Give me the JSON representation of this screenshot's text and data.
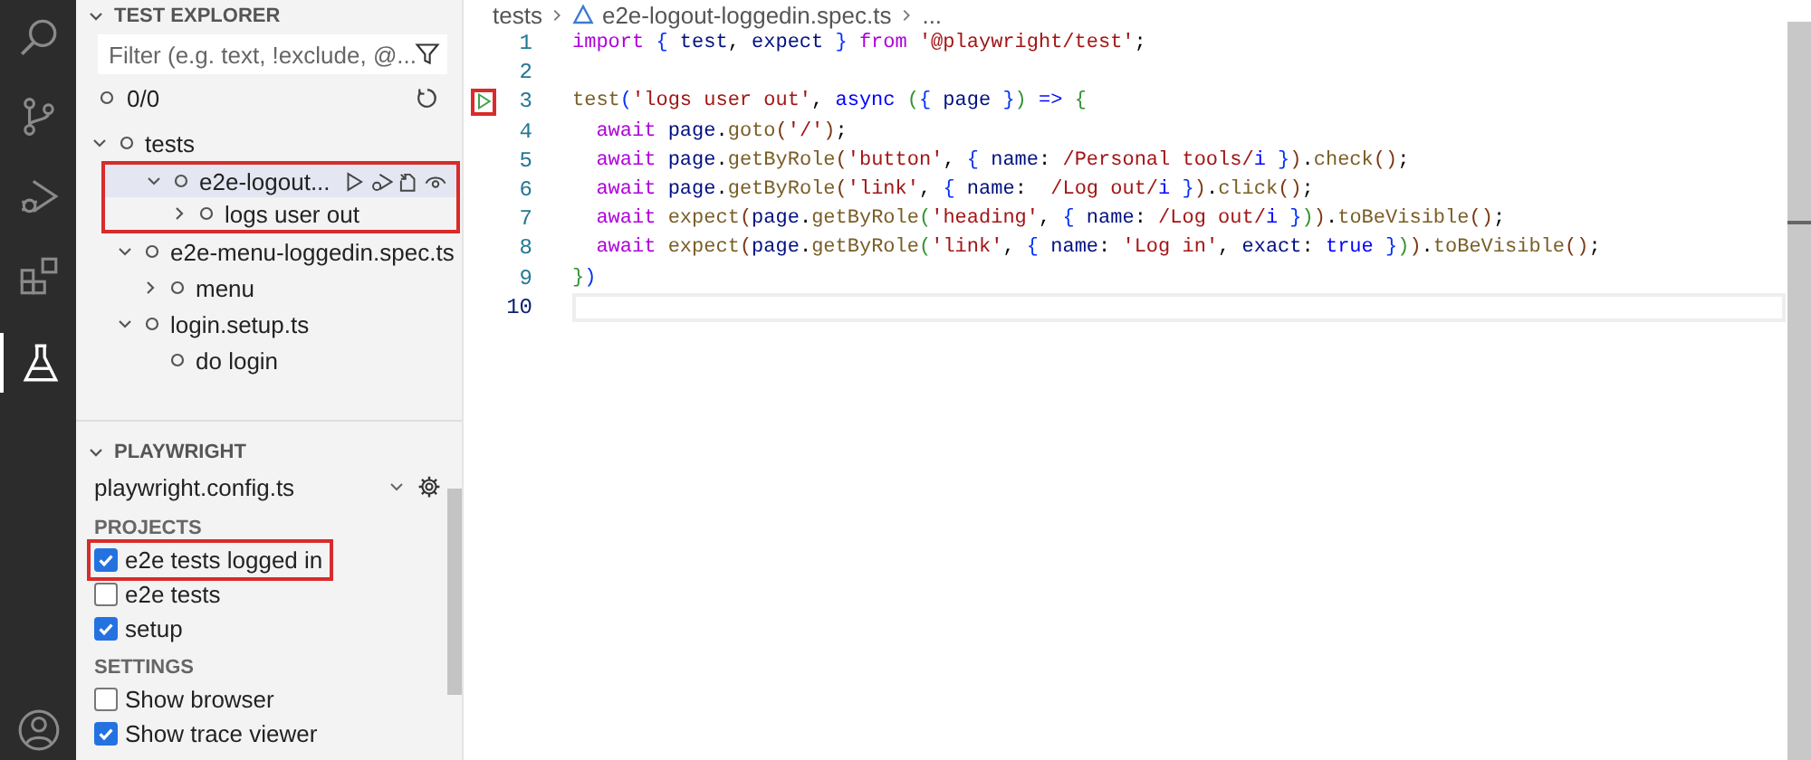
{
  "explorer": {
    "title": "TEST EXPLORER",
    "filter": {
      "placeholder": "Filter (e.g. text, !exclude, @..."
    },
    "summary": "0/0",
    "tree": [
      {
        "label": "tests",
        "expanded": true,
        "selected": false,
        "highlighted": false,
        "children": [
          {
            "label": "e2e-logout...",
            "expanded": true,
            "selected": true,
            "highlighted": true,
            "children": [
              {
                "label": "logs user out",
                "expanded": false,
                "selected": false,
                "highlighted": true
              }
            ]
          },
          {
            "label": "e2e-menu-loggedin.spec.ts",
            "expanded": true,
            "selected": false,
            "highlighted": false,
            "children": [
              {
                "label": "menu",
                "expanded": false,
                "selected": false,
                "highlighted": false
              }
            ]
          },
          {
            "label": "login.setup.ts",
            "expanded": true,
            "selected": false,
            "highlighted": false,
            "children": [
              {
                "label": "do login",
                "selected": false,
                "highlighted": false
              }
            ]
          }
        ]
      }
    ]
  },
  "playwright": {
    "title": "PLAYWRIGHT",
    "config": "playwright.config.ts",
    "sections": [
      {
        "title": "PROJECTS",
        "items": [
          {
            "label": "e2e tests logged in",
            "checked": true,
            "highlighted": true
          },
          {
            "label": "e2e tests",
            "checked": false,
            "highlighted": false
          },
          {
            "label": "setup",
            "checked": true,
            "highlighted": false
          }
        ]
      },
      {
        "title": "SETTINGS",
        "items": [
          {
            "label": "Show browser",
            "checked": false,
            "highlighted": false
          },
          {
            "label": "Show trace viewer",
            "checked": true,
            "highlighted": false
          }
        ]
      }
    ]
  },
  "breadcrumb": [
    "tests",
    "e2e-logout-loggedin.spec.ts",
    "..."
  ],
  "editor": {
    "lines": [
      {
        "number": "1",
        "tokens": [
          {
            "kind": "keyword",
            "text": "import"
          },
          {
            "kind": "brace",
            "text": " {"
          },
          {
            "kind": "variable",
            "text": " test"
          },
          {
            "kind": "plain",
            "text": ", "
          },
          {
            "kind": "variable",
            "text": "expect"
          },
          {
            "kind": "brace",
            "text": " }"
          },
          {
            "kind": "keyword",
            "text": " from"
          },
          {
            "kind": "string",
            "text": " '@playwright/test'"
          },
          {
            "kind": "plain",
            "text": ";"
          }
        ]
      },
      {
        "number": "2"
      },
      {
        "number": "3",
        "run_button": true,
        "highlighted": true,
        "tokens": [
          {
            "kind": "function",
            "text": "test"
          },
          {
            "kind": "brace",
            "text": "("
          },
          {
            "kind": "string",
            "text": "'logs user out'"
          },
          {
            "kind": "plain",
            "text": ", "
          },
          {
            "kind": "constant",
            "text": "async"
          },
          {
            "kind": "paren",
            "text": " ("
          },
          {
            "kind": "brace",
            "text": "{"
          },
          {
            "kind": "variable",
            "text": " page"
          },
          {
            "kind": "brace",
            "text": " }"
          },
          {
            "kind": "paren",
            "text": ")"
          },
          {
            "kind": "constant",
            "text": " =>"
          },
          {
            "kind": "paren",
            "text": " {"
          }
        ]
      },
      {
        "number": "4",
        "tokens": [
          {
            "kind": "keyword",
            "text": "  await"
          },
          {
            "kind": "variable",
            "text": " page"
          },
          {
            "kind": "plain",
            "text": "."
          },
          {
            "kind": "function",
            "text": "goto"
          },
          {
            "kind": "bracket",
            "text": "("
          },
          {
            "kind": "string",
            "text": "'/'"
          },
          {
            "kind": "bracket",
            "text": ")"
          },
          {
            "kind": "plain",
            "text": ";"
          }
        ]
      },
      {
        "number": "5",
        "tokens": [
          {
            "kind": "keyword",
            "text": "  await"
          },
          {
            "kind": "variable",
            "text": " page"
          },
          {
            "kind": "plain",
            "text": "."
          },
          {
            "kind": "function",
            "text": "getByRole"
          },
          {
            "kind": "bracket",
            "text": "("
          },
          {
            "kind": "string",
            "text": "'button'"
          },
          {
            "kind": "plain",
            "text": ", "
          },
          {
            "kind": "brace",
            "text": "{"
          },
          {
            "kind": "variable",
            "text": " name"
          },
          {
            "kind": "plain",
            "text": ": "
          },
          {
            "kind": "string",
            "text": "/Personal tools/"
          },
          {
            "kind": "constant",
            "text": "i"
          },
          {
            "kind": "brace",
            "text": " }"
          },
          {
            "kind": "bracket",
            "text": ")"
          },
          {
            "kind": "plain",
            "text": "."
          },
          {
            "kind": "function",
            "text": "check"
          },
          {
            "kind": "bracket",
            "text": "()"
          },
          {
            "kind": "plain",
            "text": ";"
          }
        ]
      },
      {
        "number": "6",
        "tokens": [
          {
            "kind": "keyword",
            "text": "  await"
          },
          {
            "kind": "variable",
            "text": " page"
          },
          {
            "kind": "plain",
            "text": "."
          },
          {
            "kind": "function",
            "text": "getByRole"
          },
          {
            "kind": "bracket",
            "text": "("
          },
          {
            "kind": "string",
            "text": "'link'"
          },
          {
            "kind": "plain",
            "text": ", "
          },
          {
            "kind": "brace",
            "text": "{"
          },
          {
            "kind": "variable",
            "text": " name"
          },
          {
            "kind": "plain",
            "text": ":  "
          },
          {
            "kind": "string",
            "text": "/Log out/"
          },
          {
            "kind": "constant",
            "text": "i"
          },
          {
            "kind": "brace",
            "text": " }"
          },
          {
            "kind": "bracket",
            "text": ")"
          },
          {
            "kind": "plain",
            "text": "."
          },
          {
            "kind": "function",
            "text": "click"
          },
          {
            "kind": "bracket",
            "text": "()"
          },
          {
            "kind": "plain",
            "text": ";"
          }
        ]
      },
      {
        "number": "7",
        "tokens": [
          {
            "kind": "keyword",
            "text": "  await"
          },
          {
            "kind": "function",
            "text": " expect"
          },
          {
            "kind": "bracket",
            "text": "("
          },
          {
            "kind": "variable",
            "text": "page"
          },
          {
            "kind": "plain",
            "text": "."
          },
          {
            "kind": "function",
            "text": "getByRole"
          },
          {
            "kind": "paren",
            "text": "("
          },
          {
            "kind": "string",
            "text": "'heading'"
          },
          {
            "kind": "plain",
            "text": ", "
          },
          {
            "kind": "brace",
            "text": "{"
          },
          {
            "kind": "variable",
            "text": " name"
          },
          {
            "kind": "plain",
            "text": ": "
          },
          {
            "kind": "string",
            "text": "/Log out/"
          },
          {
            "kind": "constant",
            "text": "i"
          },
          {
            "kind": "brace",
            "text": " }"
          },
          {
            "kind": "paren",
            "text": ")"
          },
          {
            "kind": "bracket",
            "text": ")"
          },
          {
            "kind": "plain",
            "text": "."
          },
          {
            "kind": "function",
            "text": "toBeVisible"
          },
          {
            "kind": "bracket",
            "text": "()"
          },
          {
            "kind": "plain",
            "text": ";"
          }
        ]
      },
      {
        "number": "8",
        "tokens": [
          {
            "kind": "keyword",
            "text": "  await"
          },
          {
            "kind": "function",
            "text": " expect"
          },
          {
            "kind": "bracket",
            "text": "("
          },
          {
            "kind": "variable",
            "text": "page"
          },
          {
            "kind": "plain",
            "text": "."
          },
          {
            "kind": "function",
            "text": "getByRole"
          },
          {
            "kind": "paren",
            "text": "("
          },
          {
            "kind": "string",
            "text": "'link'"
          },
          {
            "kind": "plain",
            "text": ", "
          },
          {
            "kind": "brace",
            "text": "{"
          },
          {
            "kind": "variable",
            "text": " name"
          },
          {
            "kind": "plain",
            "text": ": "
          },
          {
            "kind": "string",
            "text": "'Log in'"
          },
          {
            "kind": "plain",
            "text": ", "
          },
          {
            "kind": "variable",
            "text": "exact"
          },
          {
            "kind": "plain",
            "text": ": "
          },
          {
            "kind": "constant",
            "text": "true"
          },
          {
            "kind": "brace",
            "text": " }"
          },
          {
            "kind": "paren",
            "text": ")"
          },
          {
            "kind": "bracket",
            "text": ")"
          },
          {
            "kind": "plain",
            "text": "."
          },
          {
            "kind": "function",
            "text": "toBeVisible"
          },
          {
            "kind": "bracket",
            "text": "()"
          },
          {
            "kind": "plain",
            "text": ";"
          }
        ]
      },
      {
        "number": "9",
        "tokens": [
          {
            "kind": "paren",
            "text": "}"
          },
          {
            "kind": "brace",
            "text": ")"
          }
        ]
      },
      {
        "number": "10",
        "current": true
      }
    ]
  }
}
